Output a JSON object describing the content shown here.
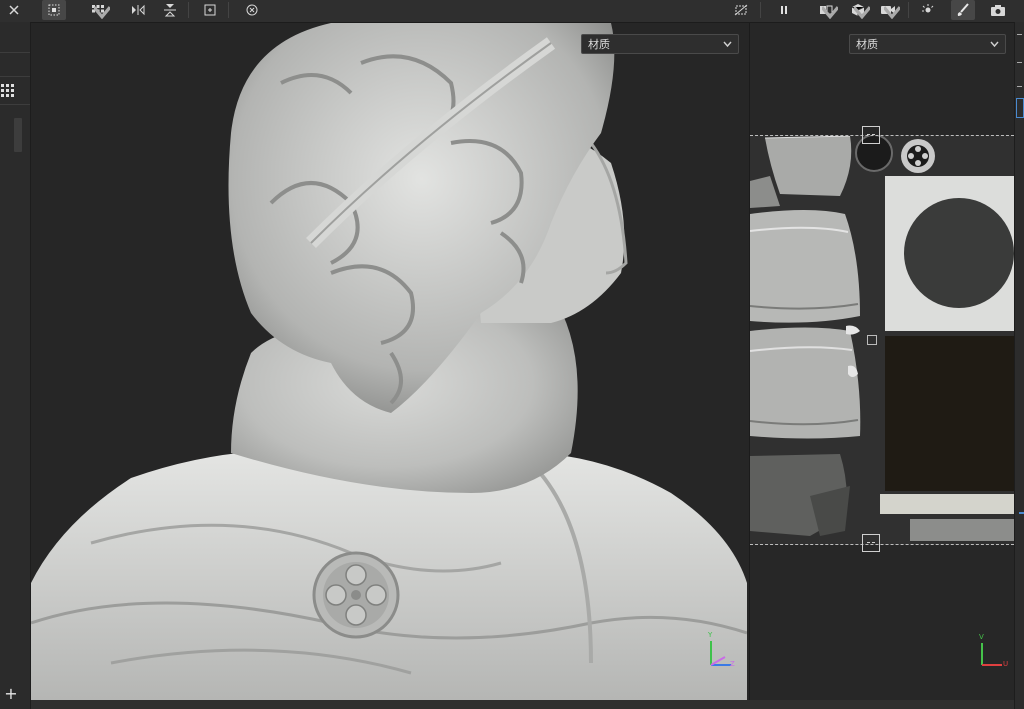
{
  "toolbar": {
    "left_buttons": [
      "close-icon",
      "grid-select-icon",
      "grid-options-icon",
      "mirror-x-icon",
      "mirror-y-icon",
      "frame-icon",
      "history-icon"
    ],
    "right_buttons": [
      "hide-icon",
      "pause-icon",
      "split-view-icon",
      "cube-icon",
      "camera-record-icon",
      "light-icon",
      "brush-icon",
      "screenshot-icon"
    ]
  },
  "viewport_3d": {
    "material_select": "材质",
    "axis_labels": {
      "x": "Z",
      "y": "Y"
    },
    "colors": {
      "axis_x": "#c96ce6",
      "axis_y": "#3ec24a",
      "axis_z": "#3a7ae6"
    }
  },
  "viewport_2d": {
    "material_select": "材质",
    "axis_labels": {
      "u": "U",
      "v": "V"
    },
    "colors": {
      "axis_u": "#e04040",
      "axis_v": "#45c24a"
    }
  },
  "left_strip": {
    "plus_label": "+"
  }
}
